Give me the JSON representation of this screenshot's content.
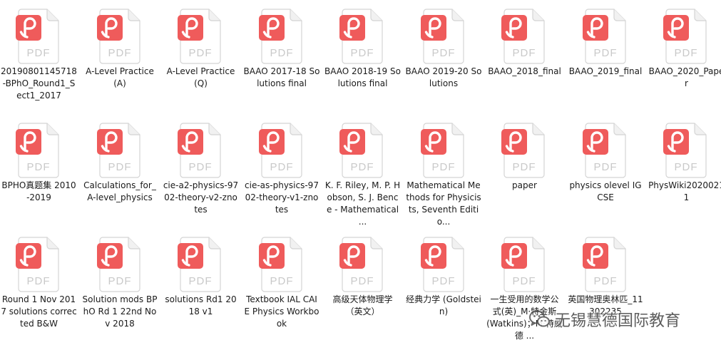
{
  "icon": {
    "name": "pdf-file-icon",
    "label": "PDF",
    "accent": "#ef5b5b",
    "label_color": "#c9c9c9"
  },
  "files": [
    {
      "name": "20190801145718-BPhO_Round1_Sect1_2017"
    },
    {
      "name": "A-Level Practice (A)"
    },
    {
      "name": "A-Level Practice (Q)"
    },
    {
      "name": "BAAO 2017-18 Solutions final"
    },
    {
      "name": "BAAO 2018-19 Solutions final"
    },
    {
      "name": "BAAO 2019-20 Solutions"
    },
    {
      "name": "BAAO_2018_final"
    },
    {
      "name": "BAAO_2019_final"
    },
    {
      "name": "BAAO_2020_Paper"
    },
    {
      "name": "BPHO真题集 2010-2019"
    },
    {
      "name": "Calculations_for_A-level_physics"
    },
    {
      "name": "cie-a2-physics-9702-theory-v2-znotes"
    },
    {
      "name": "cie-as-physics-9702-theory-v1-znotes"
    },
    {
      "name": "K. F. Riley, M. P. Hobson, S. J. Bence - Mathematical ..."
    },
    {
      "name": "Mathematical Methods for Physicists, Seventh Editio..."
    },
    {
      "name": "paper"
    },
    {
      "name": "physics olevel IGCSE"
    },
    {
      "name": "PhysWiki20200211"
    },
    {
      "name": "Round 1 Nov 2017 solutions corrected B&W"
    },
    {
      "name": "Solution mods BPhO Rd 1 22nd Nov 2018"
    },
    {
      "name": "solutions Rd1 2018 v1"
    },
    {
      "name": "Textbook IAL CAIE Physics Workbook"
    },
    {
      "name": "高级天体物理学（英文）"
    },
    {
      "name": "经典力学 (Goldstein)"
    },
    {
      "name": "一生受用的数学公式(英)_M·特金斯 (Watkins)；M·特威德 ..."
    },
    {
      "name": "英国物理奥林匹_11302235"
    }
  ],
  "watermark": {
    "text": "无锡慧德国际教育",
    "logo_icon": "wechat-icon"
  }
}
